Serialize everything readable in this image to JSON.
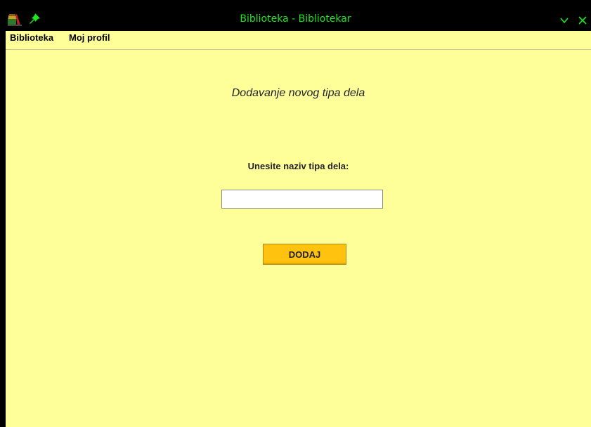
{
  "window": {
    "title": "Biblioteka - Bibliotekar",
    "title_color": "#1ee61e",
    "background": "#ffff99",
    "icons": [
      "books-app-icon",
      "pin-icon",
      "minimize-chevron-icon",
      "close-icon"
    ]
  },
  "menubar": {
    "items": [
      {
        "label": "Biblioteka"
      },
      {
        "label": "Moj profil"
      }
    ]
  },
  "form": {
    "heading": "Dodavanje novog tipa dela",
    "label": "Unesite naziv tipa dela:",
    "input_value": "",
    "button_label": "DODAJ",
    "button_color": "#ffc20e"
  }
}
